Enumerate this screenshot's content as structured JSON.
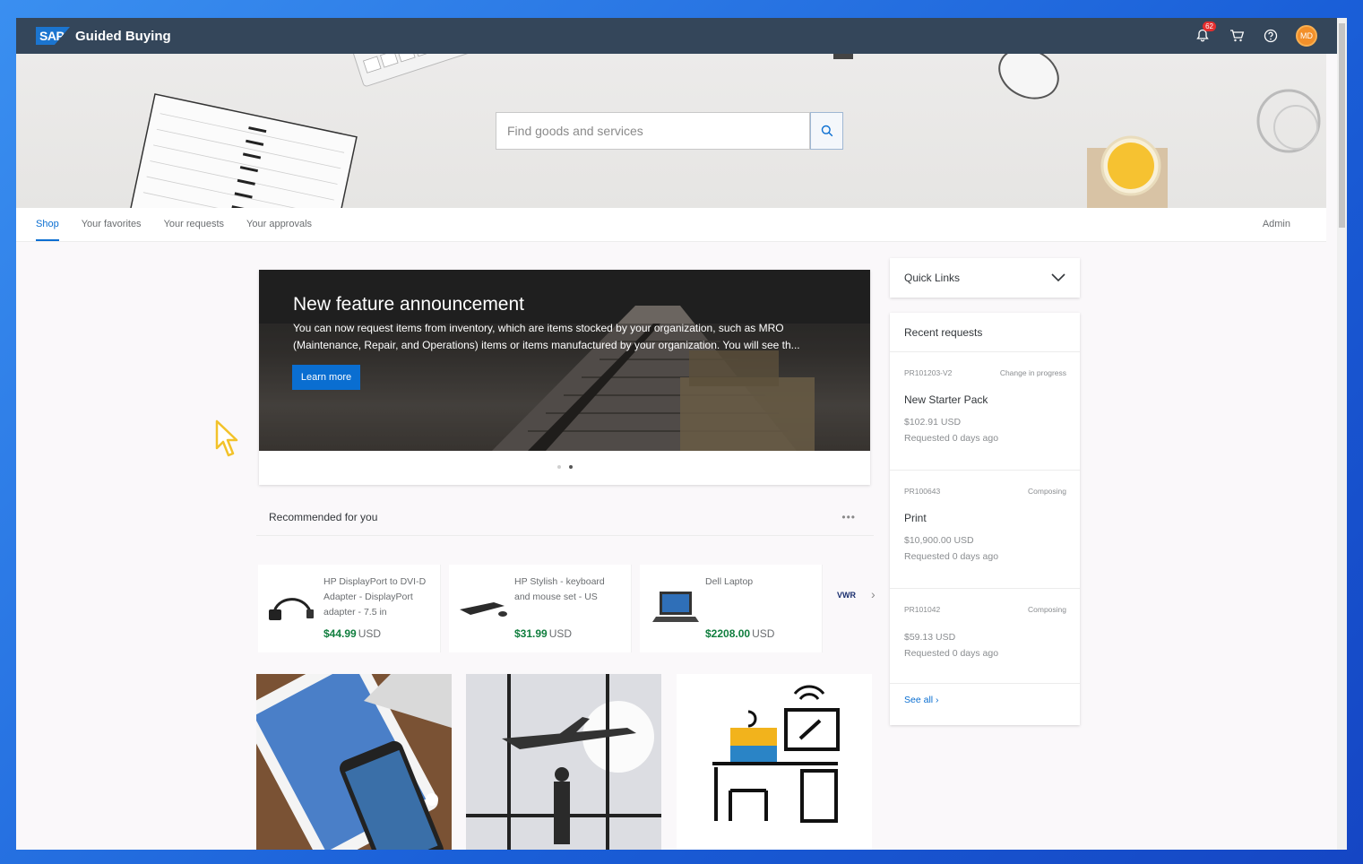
{
  "shell": {
    "logo": "SAP",
    "app_title": "Guided Buying",
    "notification_count": "62",
    "avatar_initials": "MD"
  },
  "search": {
    "placeholder": "Find goods and services"
  },
  "tabs": [
    {
      "label": "Shop"
    },
    {
      "label": "Your favorites"
    },
    {
      "label": "Your requests"
    },
    {
      "label": "Your approvals"
    }
  ],
  "admin_label": "Admin",
  "announcement": {
    "title": "New feature announcement",
    "text": "You can now request items from inventory, which are items stocked by your organization, such as MRO (Maintenance, Repair, and Operations) items or items manufactured by your organization. You will see th...",
    "button": "Learn more"
  },
  "recommended": {
    "title": "Recommended for you",
    "more": "•••",
    "products": [
      {
        "name": "HP DisplayPort to DVI-D Adapter - DisplayPort adapter - 7.5 in",
        "price": "$44.99",
        "currency": "USD"
      },
      {
        "name": "HP Stylish - keyboard and mouse set - US",
        "price": "$31.99",
        "currency": "USD"
      },
      {
        "name": "Dell Laptop",
        "price": "$2208.00",
        "currency": "USD"
      }
    ],
    "next_vendor": "VWR"
  },
  "quick_links": {
    "label": "Quick Links"
  },
  "recent_requests": {
    "title": "Recent requests",
    "items": [
      {
        "id": "PR101203-V2",
        "status": "Change in progress",
        "name": "New Starter Pack",
        "amount": "$102.91 USD",
        "when": "Requested 0 days ago"
      },
      {
        "id": "PR100643",
        "status": "Composing",
        "name": "Print",
        "amount": "$10,900.00 USD",
        "when": "Requested 0 days ago"
      },
      {
        "id": "PR101042",
        "status": "Composing",
        "name": "",
        "amount": "$59.13 USD",
        "when": "Requested 0 days ago"
      }
    ],
    "see_all": "See all"
  },
  "colors": {
    "shellbar": "#34465a",
    "accent": "#0a6ed1",
    "price": "#107e3e",
    "avatar": "#f3902a"
  }
}
